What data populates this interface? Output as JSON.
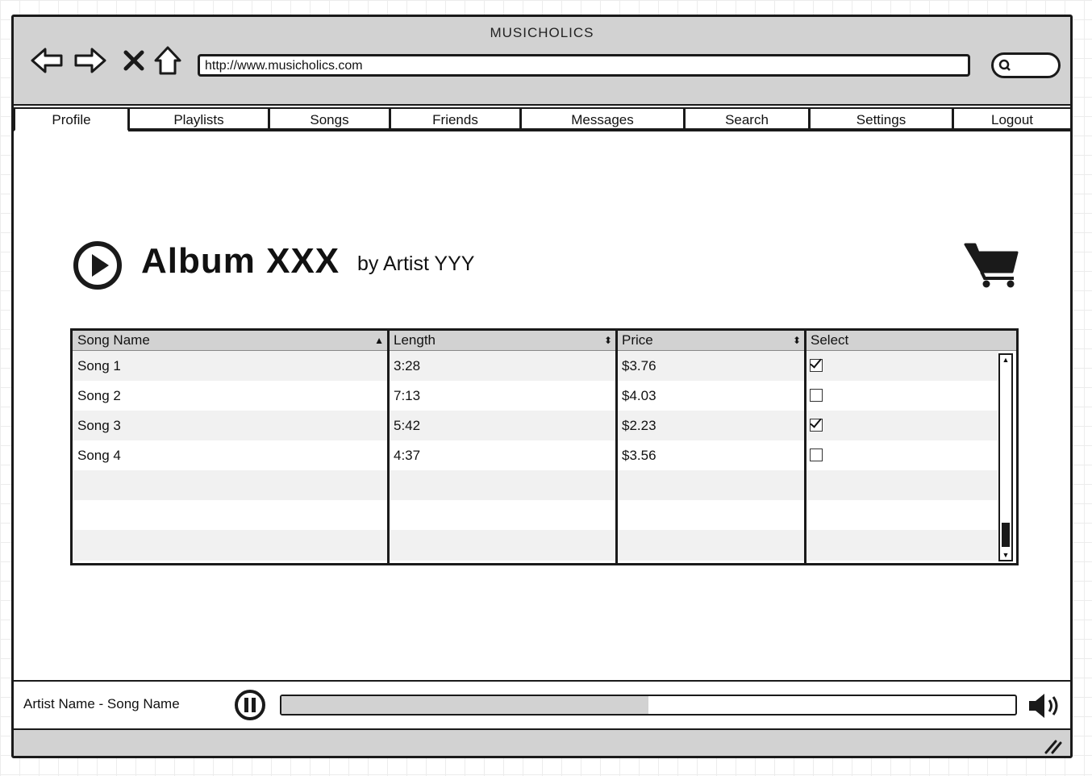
{
  "browser": {
    "title": "MUSICHOLICS",
    "url": "http://www.musicholics.com"
  },
  "menu": {
    "tabs": [
      "Profile",
      "Playlists",
      "Songs",
      "Friends",
      "Messages",
      "Search",
      "Settings",
      "Logout"
    ],
    "active": "Profile"
  },
  "album": {
    "title": "Album XXX",
    "artist": "by Artist YYY"
  },
  "table": {
    "headers": [
      "Song Name",
      "Length",
      "Price",
      "Select"
    ],
    "rows": [
      {
        "name": "Song 1",
        "length": "3:28",
        "price": "$3.76",
        "selected": true
      },
      {
        "name": "Song 2",
        "length": "7:13",
        "price": "$4.03",
        "selected": false
      },
      {
        "name": "Song 3",
        "length": "5:42",
        "price": "$2.23",
        "selected": true
      },
      {
        "name": "Song 4",
        "length": "4:37",
        "price": "$3.56",
        "selected": false
      }
    ]
  },
  "player": {
    "now_playing": "Artist Name - Song Name",
    "progress": 0.5
  },
  "colors": {
    "chrome": "#d2d2d2",
    "ink": "#1a1a1a",
    "row_alt": "#f1f1f1"
  }
}
